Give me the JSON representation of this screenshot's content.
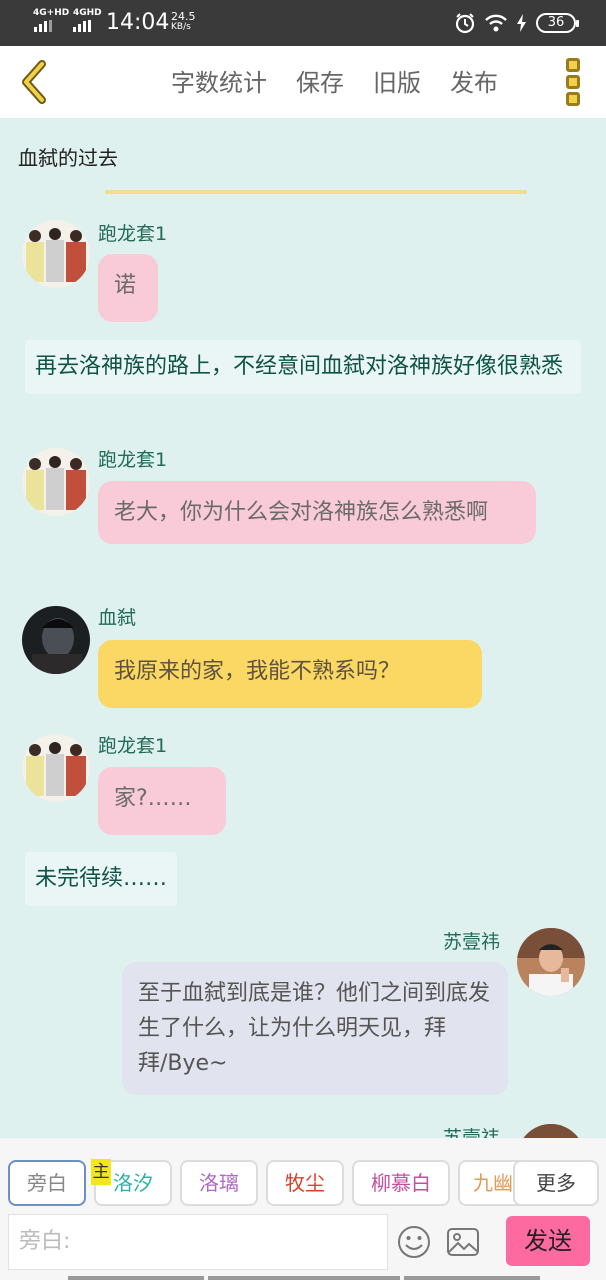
{
  "status_bar": {
    "network1": "4G+HD",
    "network2": "4GHD",
    "time": "14:04",
    "speed_value": "24.5",
    "speed_unit": "KB/s",
    "battery": "36"
  },
  "header": {
    "back_icon": "chevron-left-icon",
    "actions": [
      "字数统计",
      "保存",
      "旧版",
      "发布"
    ],
    "more_icon": "three-squares-menu-icon"
  },
  "chat": {
    "title": "血弑的过去",
    "messages": [
      {
        "speaker": "跑龙套1",
        "text": "诺"
      },
      {
        "narration": "再去洛神族的路上，不经意间血弑对洛神族好像很熟悉"
      },
      {
        "speaker": "跑龙套1",
        "text": "老大，你为什么会对洛神族怎么熟悉啊"
      },
      {
        "speaker": "血弑",
        "text": "我原来的家，我能不熟系吗？"
      },
      {
        "speaker": "跑龙套1",
        "text": "家?……"
      },
      {
        "narration": "未完待续……"
      },
      {
        "speaker": "苏壹祎",
        "text": "至于血弑到底是谁？他们之间到底发生了什么，让为什么明天见，拜拜/Bye~"
      },
      {
        "speaker": "苏壹祎",
        "text": ""
      }
    ]
  },
  "roles": {
    "badge": "主",
    "chips": [
      {
        "label": "旁白",
        "color": "#888888"
      },
      {
        "label": "洛汐",
        "color": "#2eb0a9"
      },
      {
        "label": "洛璃",
        "color": "#b06ac8"
      },
      {
        "label": "牧尘",
        "color": "#d8402b"
      },
      {
        "label": "柳慕白",
        "color": "#c64ea0"
      },
      {
        "label": "九幽",
        "color": "#e39a55"
      },
      {
        "label": "更多",
        "color": "#444444"
      }
    ]
  },
  "input": {
    "placeholder": "旁白:",
    "send_label": "发送"
  },
  "colors": {
    "accent_send": "#fd6aa0",
    "pink_bubble": "#f9cad7",
    "yellow_bubble": "#fbd764",
    "background": "#dff1ef"
  }
}
